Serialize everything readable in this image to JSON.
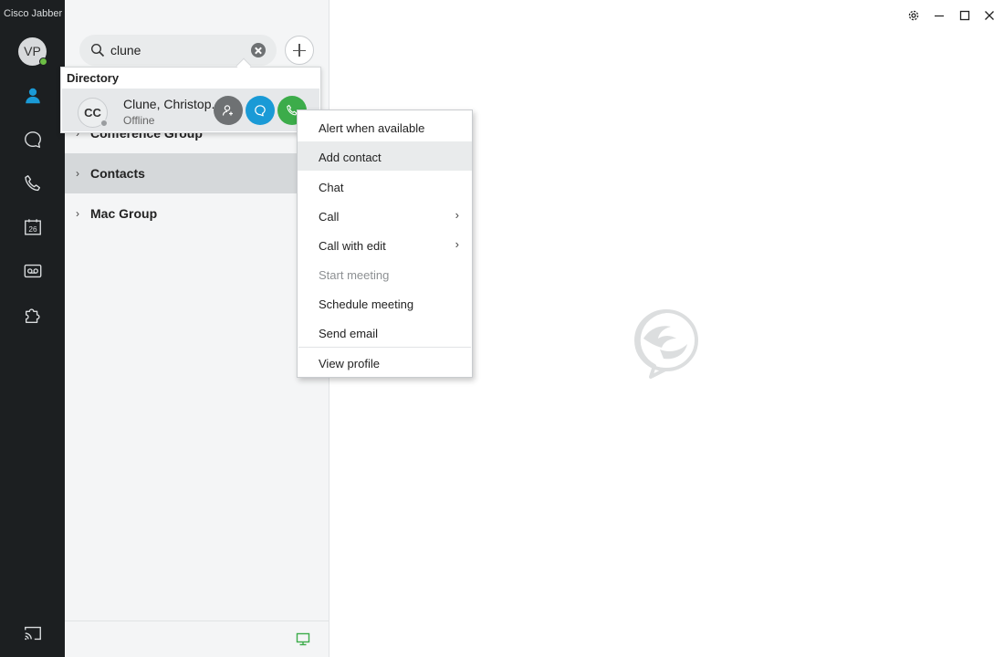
{
  "app": {
    "title": "Cisco Jabber"
  },
  "user": {
    "initials": "VP",
    "presence_color": "#6cbe45"
  },
  "rail": {
    "icons": [
      "contacts-icon",
      "chats-icon",
      "calls-icon",
      "calendar-icon",
      "voicemail-icon",
      "plugins-icon",
      "cast-icon"
    ],
    "calendar_day": "26",
    "active_color": "#1a9ad6"
  },
  "search": {
    "value": "clune"
  },
  "groups": [
    {
      "label": "Conference Group"
    },
    {
      "label": "Contacts"
    },
    {
      "label": "Mac Group"
    }
  ],
  "directory": {
    "title": "Directory",
    "result": {
      "initials": "CC",
      "name": "Clune, Christop...",
      "status": "Offline"
    }
  },
  "context_menu": {
    "items": [
      {
        "label": "Alert when available"
      },
      {
        "label": "Add contact"
      },
      {
        "label": "Chat"
      },
      {
        "label": "Call"
      },
      {
        "label": "Call with edit"
      },
      {
        "label": "Start meeting"
      },
      {
        "label": "Schedule meeting"
      },
      {
        "label": "Send email"
      },
      {
        "label": "View profile"
      }
    ],
    "submenu_glyph": "›"
  }
}
